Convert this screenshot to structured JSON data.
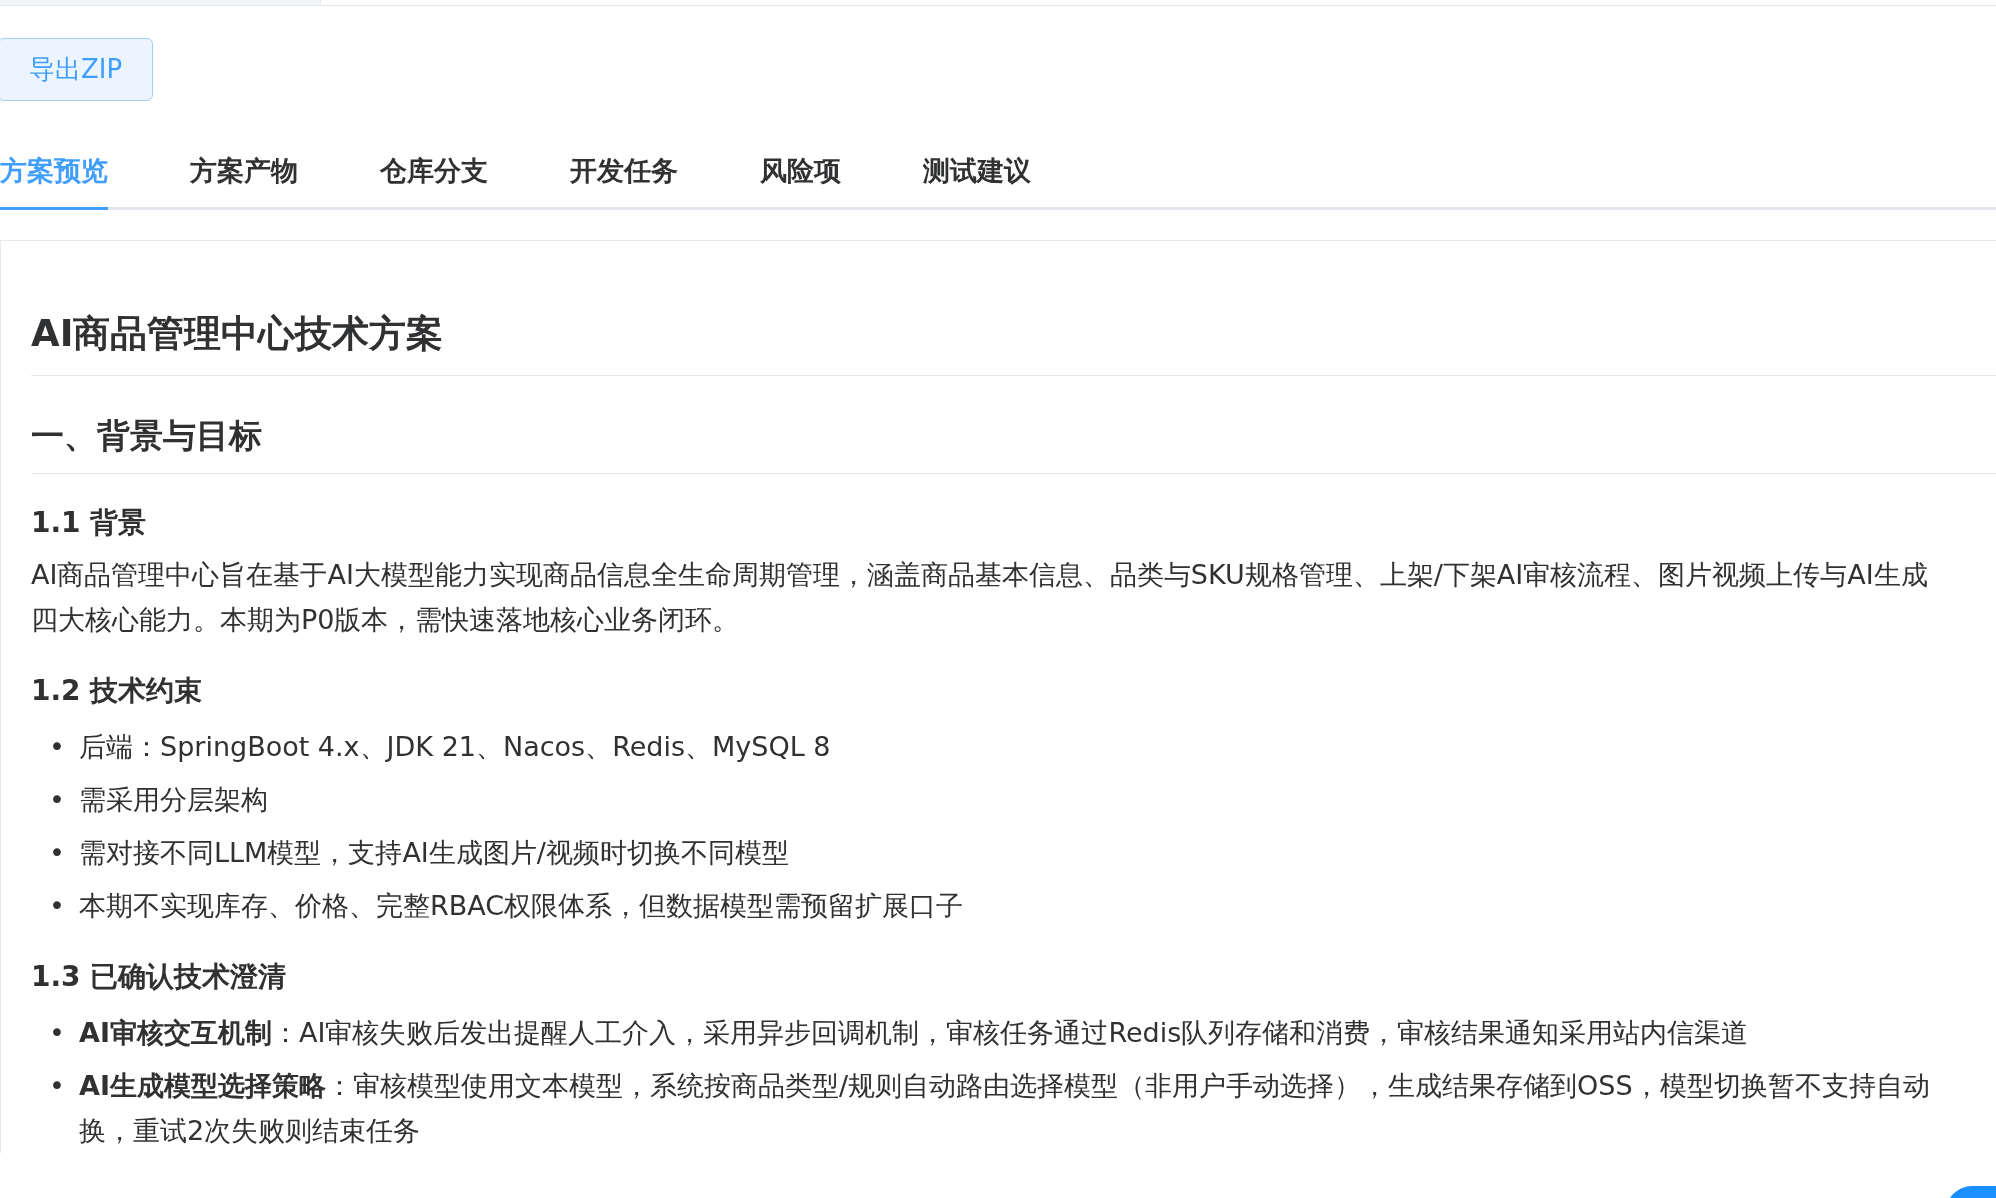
{
  "toolbar": {
    "export_button": "导出ZIP"
  },
  "tabs": [
    {
      "label": "方案预览",
      "selected": true
    },
    {
      "label": "方案产物",
      "selected": false
    },
    {
      "label": "仓库分支",
      "selected": false
    },
    {
      "label": "开发任务",
      "selected": false
    },
    {
      "label": "风险项",
      "selected": false
    },
    {
      "label": "测试建议",
      "selected": false
    }
  ],
  "document": {
    "title": "AI商品管理中心技术方案",
    "blocks": [
      {
        "kind": "h2",
        "text": "一、背景与目标"
      },
      {
        "kind": "h3",
        "text": "1.1 背景"
      },
      {
        "kind": "para",
        "lines": [
          "AI商品管理中心旨在基于AI大模型能力实现商品信息全生命周期管理，涵盖商品基本信息、品类与SKU规格管理、上架/下架AI审核流程、图片视频上传与AI生成",
          "四大核心能力。本期为P0版本，需快速落地核心业务闭环。"
        ]
      },
      {
        "kind": "h3",
        "text": "1.2 技术约束"
      },
      {
        "kind": "list",
        "items": [
          {
            "marker": "•",
            "lines": [
              "后端：SpringBoot 4.x、JDK 21、Nacos、Redis、MySQL 8"
            ]
          },
          {
            "marker": "•",
            "lines": [
              "需采用分层架构"
            ]
          },
          {
            "marker": "•",
            "lines": [
              "需对接不同LLM模型，支持AI生成图片/视频时切换不同模型"
            ]
          },
          {
            "marker": "•",
            "lines": [
              "本期不实现库存、价格、完整RBAC权限体系，但数据模型需预留扩展口子"
            ]
          }
        ]
      },
      {
        "kind": "h3",
        "text": "1.3 已确认技术澄清"
      },
      {
        "kind": "list",
        "items": [
          {
            "marker": "•",
            "lines": [
              "**AI审核交互机制**：AI审核失败后发出提醒人工介入，采用异步回调机制，审核任务通过Redis队列存储和消费，审核结果通知采用站内信渠道"
            ]
          },
          {
            "marker": "•",
            "lines": [
              "**AI生成模型选择策略**：审核模型使用文本模型，系统按商品类型/规则自动路由选择模型（非用户手动选择），生成结果存储到OSS，模型切换暂不支持自动",
              "换，重试2次失败则结束任务"
            ]
          }
        ]
      }
    ]
  }
}
